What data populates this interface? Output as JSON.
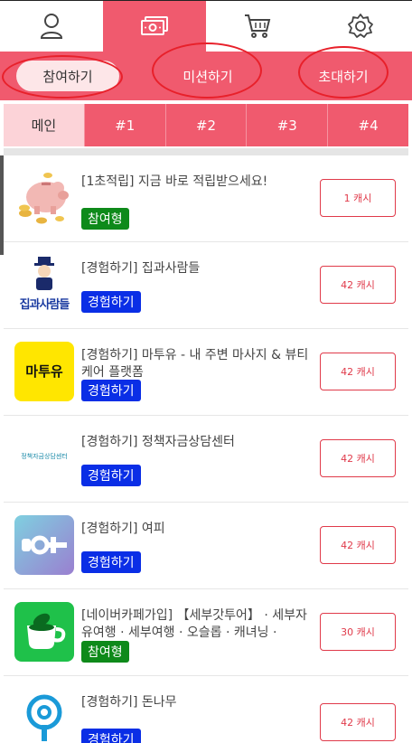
{
  "nav": {
    "items": [
      {
        "icon": "person-icon"
      },
      {
        "icon": "cash-icon",
        "active": true
      },
      {
        "icon": "cart-icon"
      },
      {
        "icon": "gear-icon"
      }
    ]
  },
  "subtabs": [
    "참여하기",
    "미션하기",
    "초대하기"
  ],
  "numtabs": [
    "메인",
    "#1",
    "#2",
    "#3",
    "#4"
  ],
  "list": [
    {
      "title": "[1초적립] 지금 바로 적립받으세요!",
      "badge": "참여형",
      "badge_color": "#0e8a1a",
      "cash": "1 캐시",
      "thumb_icon": "piggy-bank-icon"
    },
    {
      "title": "[경험하기] 집과사람들",
      "badge": "경험하기",
      "badge_color": "#0a2ee6",
      "cash": "42 캐시",
      "thumb_text": "집과사람들"
    },
    {
      "title": "[경험하기] 마투유 - 내 주변 마사지 & 뷰티케어 플랫폼",
      "badge": "경험하기",
      "badge_color": "#0a2ee6",
      "cash": "42 캐시",
      "thumb_text": "마투유"
    },
    {
      "title": "[경험하기] 정책자금상담센터",
      "badge": "경험하기",
      "badge_color": "#0a2ee6",
      "cash": "42 캐시",
      "thumb_text": "정책자금상담센터"
    },
    {
      "title": "[경험하기] 여피",
      "badge": "경험하기",
      "badge_color": "#0a2ee6",
      "cash": "42 캐시",
      "thumb_icon": "yeopi-logo-icon"
    },
    {
      "title": "[네이버카페가입] 【세부갓투어】 · 세부자유여행 · 세부여행 · 오슬롭 · 캐녀닝 ·",
      "badge": "참여형",
      "badge_color": "#0e8a1a",
      "cash": "30 캐시",
      "thumb_icon": "cafe-cup-icon"
    },
    {
      "title": "[경험하기] 돈나무",
      "badge": "경험하기",
      "badge_color": "#0a2ee6",
      "cash": "42 캐시",
      "thumb_icon": "money-tree-icon"
    }
  ]
}
